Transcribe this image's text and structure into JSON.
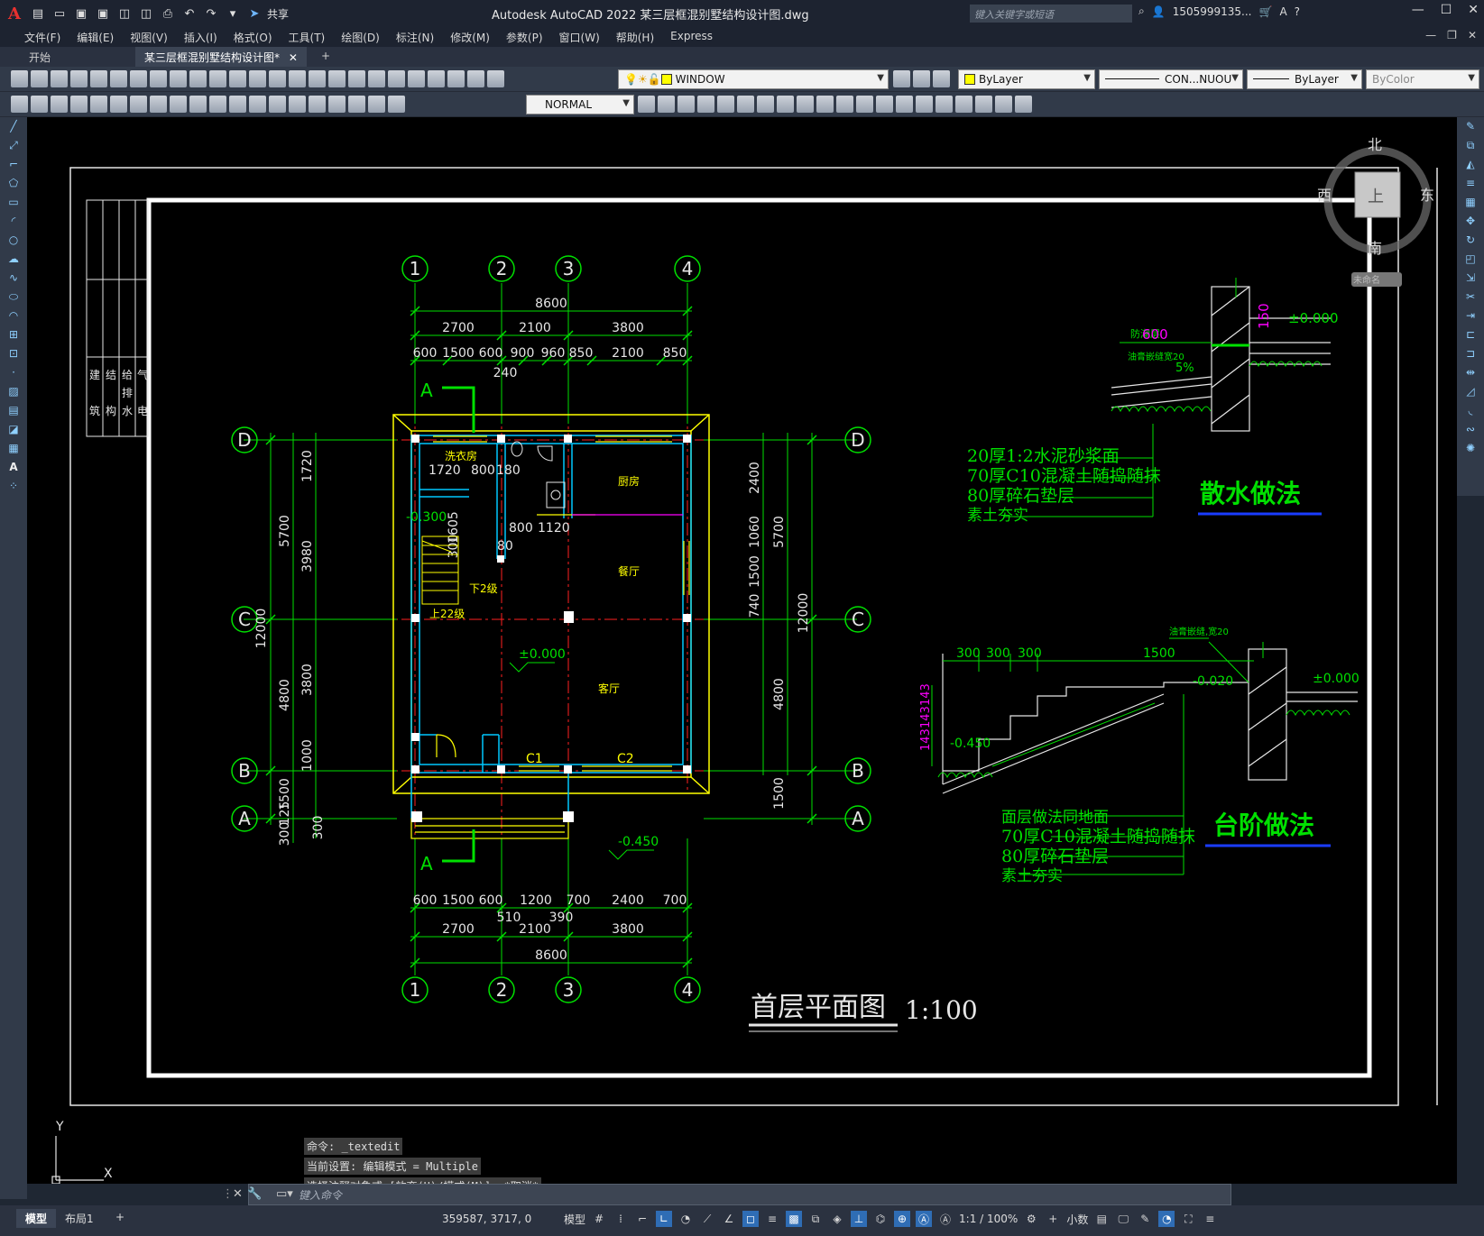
{
  "app": {
    "title": "Autodesk AutoCAD 2022    某三层框混别墅结构设计图.dwg",
    "search_placeholder": "键入关键字或短语",
    "user": "1505999135...",
    "share": "共享"
  },
  "menu": [
    "文件(F)",
    "编辑(E)",
    "视图(V)",
    "插入(I)",
    "格式(O)",
    "工具(T)",
    "绘图(D)",
    "标注(N)",
    "修改(M)",
    "参数(P)",
    "窗口(W)",
    "帮助(H)",
    "Express"
  ],
  "tabs": {
    "start": "开始",
    "doc": "某三层框混别墅结构设计图*",
    "new": "+"
  },
  "toolbar": {
    "layer": "WINDOW",
    "color": "ByLayer",
    "linetype": "CON...NUOU",
    "lineweight": "ByLayer",
    "plotstyle": "ByColor",
    "textstyle": "NORMAL"
  },
  "viewcube": {
    "north": "北",
    "south": "南",
    "east": "东",
    "west": "西",
    "top": "上",
    "wcs": "未命名"
  },
  "drawing": {
    "axes_top": [
      "1",
      "2",
      "3",
      "4"
    ],
    "axes_side": [
      "D",
      "C",
      "B",
      "A"
    ],
    "dims_top": {
      "total": "8600",
      "seg": [
        "2700",
        "2100",
        "3800"
      ],
      "detail": [
        "600",
        "1500",
        "600",
        "900",
        "960",
        "850",
        "2100",
        "850"
      ],
      "extra": "240"
    },
    "dims_bottom": {
      "detail": [
        "600",
        "1500",
        "600",
        "1200",
        "700",
        "2400",
        "700"
      ],
      "extra": [
        "510",
        "390"
      ],
      "seg": [
        "2700",
        "2100",
        "3800"
      ],
      "total": "8600"
    },
    "dims_left": {
      "outer": "12000",
      "mid": [
        "5700",
        "4800",
        "1500"
      ],
      "inner": [
        "1720",
        "3980",
        "3800",
        "1000",
        "300"
      ],
      "small": [
        "300",
        "125",
        "1605",
        "300"
      ]
    },
    "dims_right": {
      "outer": "12000",
      "mid": [
        "5700",
        "4800",
        "1500"
      ],
      "inner": [
        "2400",
        "1060",
        "1500",
        "740"
      ]
    },
    "rooms": {
      "laundry": "洗衣房",
      "kitchen": "厨房",
      "dining": "餐厅",
      "living": "客厅",
      "down": "下2级",
      "up": "上22级"
    },
    "room_dims": [
      "1720",
      "800",
      "180",
      "800",
      "1120",
      "80"
    ],
    "levels": {
      "a": "-0.300",
      "b": "±0.000",
      "c": "-0.450"
    },
    "windows": [
      "C1",
      "C2"
    ],
    "section_mark": "A",
    "title": "首层平面图",
    "scale": "1:100",
    "detail1": {
      "title": "散水做法",
      "notes": [
        "20厚1:2水泥砂浆面",
        "70厚C10混凝土随捣随抹",
        "80厚碎石垫层",
        "素土夯实"
      ],
      "labels": [
        "防潮层",
        "油膏嵌缝宽20",
        "600",
        "5%",
        "150",
        "±0.000"
      ]
    },
    "detail2": {
      "title": "台阶做法",
      "notes": [
        "面层做法同地面",
        "70厚C10混凝土随捣随抹",
        "80厚碎石垫层",
        "素土夯实"
      ],
      "labels": [
        "油膏嵌缝,宽20",
        "300",
        "300",
        "300",
        "1500",
        "-0.020",
        "±0.000",
        "-0.450",
        "143",
        "143",
        "143"
      ]
    },
    "titleblock": [
      "建",
      "筑",
      "结",
      "构",
      "给",
      "排",
      "水",
      "电",
      "气"
    ]
  },
  "command": {
    "history": [
      "命令: _textedit",
      "当前设置: 编辑模式 = Multiple",
      "选择注释对象或 [放弃(U)/模式(M)]: *取消*"
    ],
    "placeholder": "键入命令"
  },
  "status": {
    "model_tab": "模型",
    "layout_tab": "布局1",
    "add": "+",
    "coords": "359587, 3717, 0",
    "space": "模型",
    "scale": "1:1 / 100%",
    "units": "小数"
  }
}
